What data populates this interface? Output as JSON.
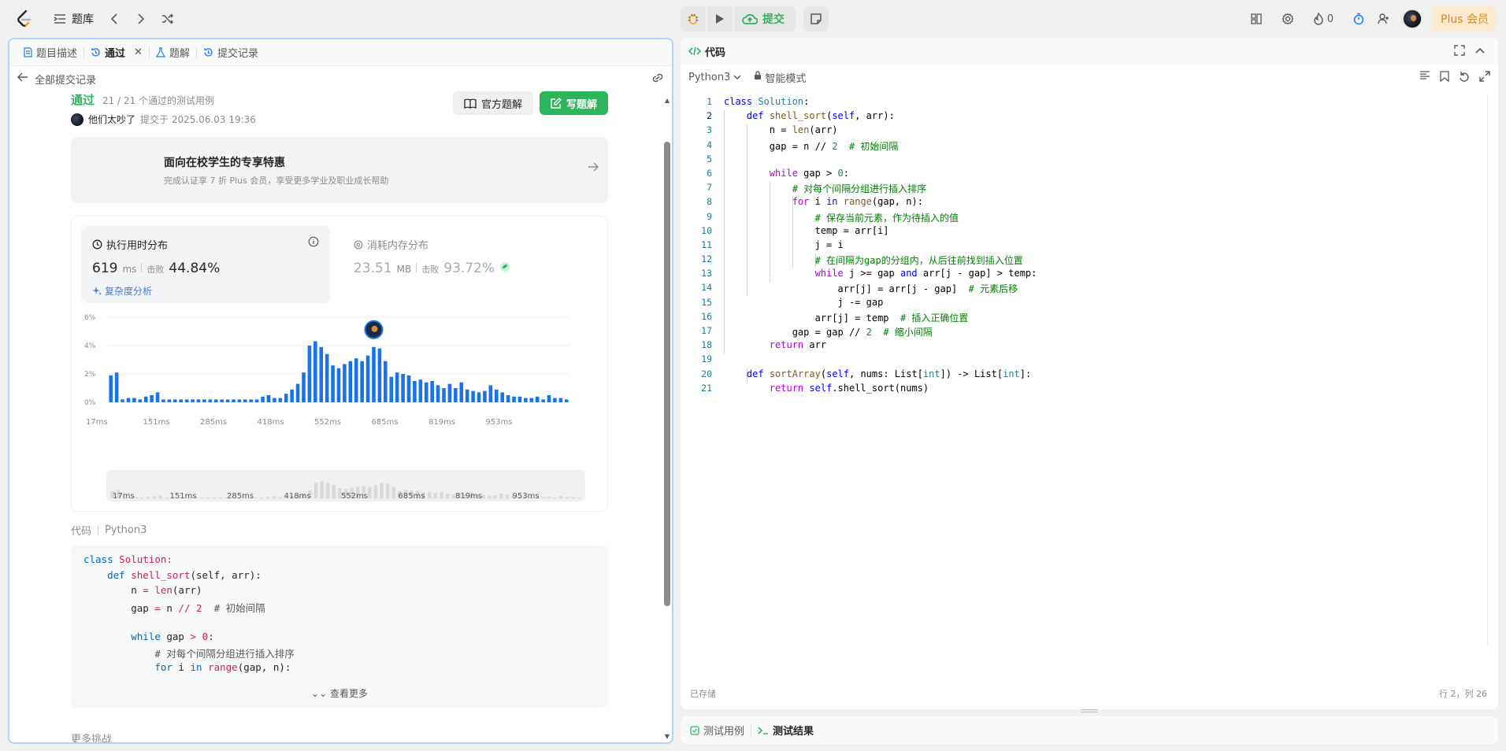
{
  "topnav": {
    "title": "题库",
    "submit_label": "提交",
    "fire_count": "0",
    "plus_label": "Plus 会员"
  },
  "left": {
    "tabs": [
      {
        "label": "题目描述"
      },
      {
        "label": "通过"
      },
      {
        "label": "题解"
      },
      {
        "label": "提交记录"
      }
    ],
    "back_label": "全部提交记录",
    "status": "通过",
    "testcases": "21 / 21 个通过的测试用例",
    "user": "他们太吵了",
    "submit_time": "提交于 2025.06.03 19:36",
    "official_btn": "官方题解",
    "write_btn": "写题解",
    "promo": {
      "title": "面向在校学生的专享特惠",
      "sub": "完成认证享 7 折 Plus 会员，享受更多学业及职业成长帮助"
    },
    "runtime": {
      "title": "执行用时分布",
      "value": "619",
      "unit": "ms",
      "beat_label": "击败",
      "beat": "44.84%",
      "complexity": "复杂度分析"
    },
    "memory": {
      "title": "消耗内存分布",
      "value": "23.51",
      "unit": "MB",
      "beat_label": "击败",
      "beat": "93.72%"
    },
    "code_label": "代码",
    "code_lang": "Python3",
    "code_lines": [
      "class Solution:",
      "    def shell_sort(self, arr):",
      "        n = len(arr)",
      "        gap = n // 2  # 初始间隔",
      "",
      "        while gap > 0:",
      "            # 对每个间隔分组进行插入排序",
      "            for i in range(gap, n):"
    ],
    "more_label": "查看更多",
    "more_challenges": "更多挑战"
  },
  "right": {
    "tab": "代码",
    "lang": "Python3",
    "mode": "智能模式",
    "saved": "已存储",
    "cursor": "行 2，列 26",
    "line_numbers": [
      "1",
      "2",
      "3",
      "4",
      "5",
      "6",
      "7",
      "8",
      "9",
      "10",
      "11",
      "12",
      "13",
      "14",
      "15",
      "16",
      "17",
      "18",
      "19",
      "20",
      "21"
    ]
  },
  "bottom": {
    "tab1": "测试用例",
    "tab2": "测试结果"
  },
  "chart_data": {
    "type": "bar",
    "title": "",
    "xlabel": "",
    "ylabel": "",
    "ylim": [
      0,
      6
    ],
    "y_ticks": [
      "0%",
      "2%",
      "4%",
      "6%"
    ],
    "x_ticks": [
      "17ms",
      "151ms",
      "285ms",
      "418ms",
      "552ms",
      "685ms",
      "819ms",
      "953ms"
    ],
    "values": [
      1.9,
      2.1,
      0.2,
      0.3,
      0.3,
      0.2,
      0.4,
      0.5,
      0.7,
      0.2,
      0.2,
      0.2,
      0.2,
      0.2,
      0.2,
      0.2,
      0.2,
      0.2,
      0.2,
      0.2,
      0.2,
      0.2,
      0.2,
      0.2,
      0.2,
      0.2,
      0.4,
      0.5,
      0.3,
      0.3,
      0.6,
      0.9,
      1.3,
      2.1,
      4.0,
      4.3,
      3.9,
      3.4,
      2.6,
      2.4,
      2.7,
      2.9,
      3.1,
      2.9,
      3.3,
      3.9,
      3.8,
      2.9,
      1.8,
      2.1,
      2.0,
      1.9,
      1.5,
      1.6,
      1.4,
      1.5,
      1.2,
      1.0,
      1.3,
      1.0,
      1.4,
      0.9,
      0.8,
      0.7,
      0.8,
      1.2,
      0.9,
      0.7,
      0.5,
      0.4,
      0.4,
      0.3,
      0.3,
      0.4,
      0.2,
      0.5,
      0.3,
      0.3,
      0.2
    ],
    "highlight_index": 45,
    "grid": true
  }
}
